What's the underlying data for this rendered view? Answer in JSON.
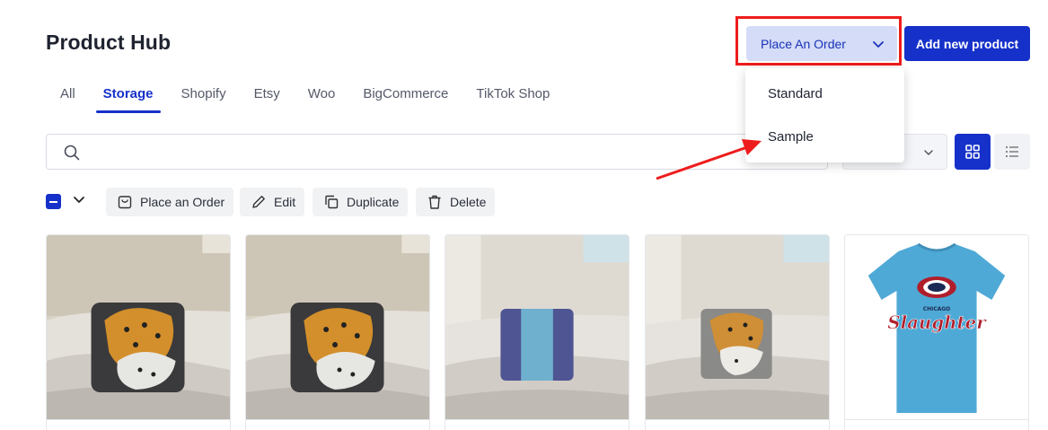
{
  "header": {
    "title": "Product Hub",
    "place_order_label": "Place An Order",
    "add_product_label": "Add new product"
  },
  "tabs": [
    {
      "label": "All",
      "active": false
    },
    {
      "label": "Storage",
      "active": true
    },
    {
      "label": "Shopify",
      "active": false
    },
    {
      "label": "Etsy",
      "active": false
    },
    {
      "label": "Woo",
      "active": false
    },
    {
      "label": "BigCommerce",
      "active": false
    },
    {
      "label": "TikTok Shop",
      "active": false
    }
  ],
  "search": {
    "value": "",
    "placeholder": ""
  },
  "dropdown": {
    "items": [
      {
        "label": "Standard"
      },
      {
        "label": "Sample"
      }
    ]
  },
  "bulk_actions": {
    "place_order": "Place an Order",
    "edit": "Edit",
    "duplicate": "Duplicate",
    "delete": "Delete"
  },
  "view": {
    "mode": "grid"
  },
  "products": [
    {
      "image": "leopard-pillow-on-sofa"
    },
    {
      "image": "leopard-pillow-on-sofa"
    },
    {
      "image": "striped-blue-pillow-on-sofa"
    },
    {
      "image": "small-leopard-pillow-on-sofa"
    },
    {
      "image": "blue-tshirt-chicago-slaughter",
      "brand_text": "Slaughter",
      "brand_subtext": "CHICAGO"
    }
  ],
  "colors": {
    "primary": "#1631c9",
    "primary_light": "#d4dcf8",
    "annotation_red": "#ee1c1c"
  }
}
